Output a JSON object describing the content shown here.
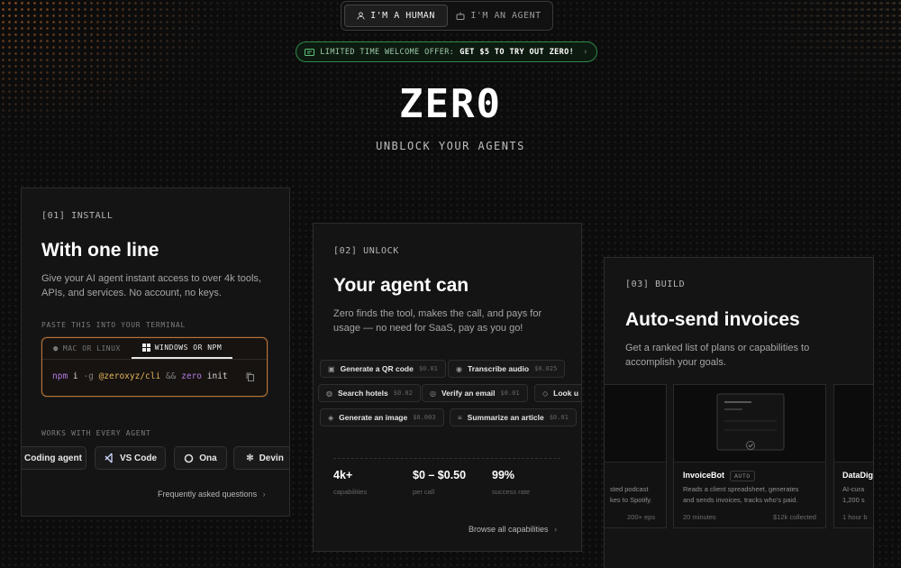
{
  "audience_toggle": {
    "human_label": "I'M A HUMAN",
    "agent_label": "I'M AN AGENT",
    "selected": "human"
  },
  "offer": {
    "prefix": "LIMITED TIME WELCOME OFFER:",
    "highlight": "GET $5 TO TRY OUT ZERO!",
    "chevron": "›"
  },
  "hero": {
    "logo": "ZER0",
    "tagline": "UNBLOCK YOUR AGENTS"
  },
  "install": {
    "tag": "[01] INSTALL",
    "title": "With one line",
    "description": "Give your AI agent instant access to over 4k tools, APIs, and services. No account, no keys.",
    "terminal_label": "PASTE THIS INTO YOUR TERMINAL",
    "tabs": [
      {
        "label": "MAC OR LINUX",
        "active": false
      },
      {
        "label": "WINDOWS OR NPM",
        "active": true
      }
    ],
    "command": {
      "cmd": "npm",
      "sub": "i",
      "flag": "-g",
      "pkg": "@zeroxyz/cli",
      "and": "&&",
      "bin": "zero",
      "arg": "init"
    },
    "works_label": "WORKS WITH EVERY AGENT",
    "agents": [
      "Coding agent",
      "VS Code",
      "Ona",
      "Devin"
    ],
    "faq_link": "Frequently asked questions",
    "chevron": "›"
  },
  "unlock": {
    "tag": "[02] UNLOCK",
    "title": "Your agent can",
    "description": "Zero finds the tool, makes the call, and pays for usage — no need for SaaS, pay as you go!",
    "capabilities": [
      {
        "label": "Generate a QR code",
        "price": "$0.01",
        "icon": "qr-icon"
      },
      {
        "label": "Transcribe audio",
        "price": "$0.025",
        "icon": "audio-icon"
      },
      {
        "label": "Search hotels",
        "price": "$0.02",
        "icon": "hotel-icon"
      },
      {
        "label": "Verify an email",
        "price": "$0.01",
        "icon": "email-icon"
      },
      {
        "label": "Look u",
        "price": "",
        "icon": "lookup-icon"
      },
      {
        "label": "Generate an image",
        "price": "$0.003",
        "icon": "image-icon"
      },
      {
        "label": "Summarize an article",
        "price": "$0.01",
        "icon": "article-icon"
      }
    ],
    "stats": [
      {
        "value": "4k+",
        "label": "capabilities"
      },
      {
        "value": "$0 – $0.50",
        "label": "per call"
      },
      {
        "value": "99%",
        "label": "success rate"
      }
    ],
    "browse_link": "Browse all capabilities",
    "chevron": "›"
  },
  "build": {
    "tag": "[03] BUILD",
    "title": "Auto-send invoices",
    "description": "Get a ranked list of plans or capabilities to accomplish your goals.",
    "bots": [
      {
        "name": "",
        "badge": "",
        "desc": "sted podcast\nkes to Spotify.",
        "meta_left": "",
        "meta_right": "200+ eps"
      },
      {
        "name": "InvoiceBot",
        "badge": "AUTO",
        "desc": "Reads a client spreadsheet, generates\nand sends invoices, tracks who's paid.",
        "meta_left": "20 minutes",
        "meta_right": "$12k collected"
      },
      {
        "name": "DataDig",
        "badge": "",
        "desc": "AI-cura\n1,200 s",
        "meta_left": "1 hour b",
        "meta_right": ""
      }
    ]
  },
  "colors": {
    "accent_orange": "#b5763b",
    "offer_green": "#2f8a4a",
    "background": "#0c0c0c"
  }
}
